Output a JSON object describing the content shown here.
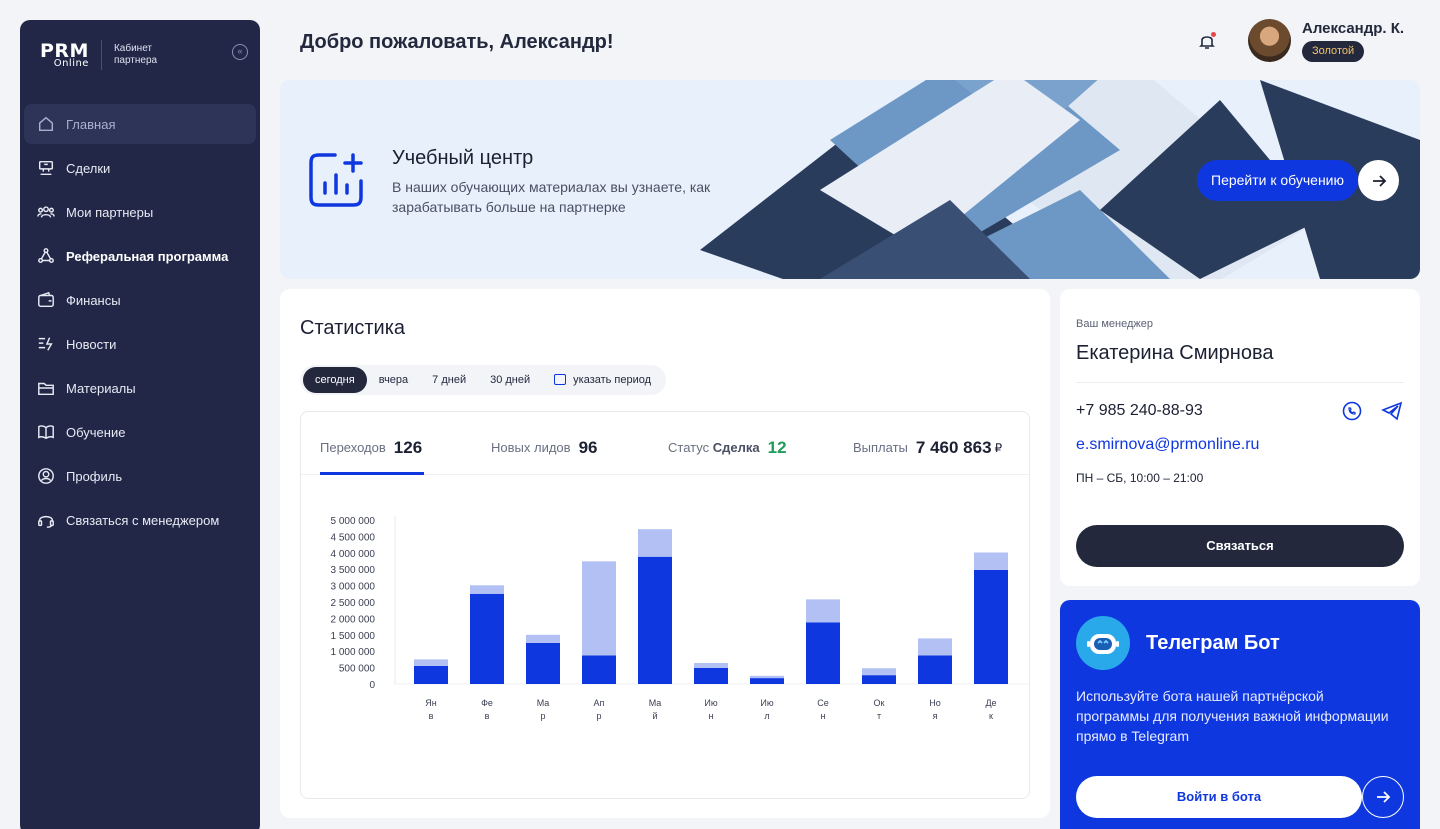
{
  "sidebar": {
    "logo_main": "PRM",
    "logo_sub": "Online",
    "logo_caption": "Кабинет партнера",
    "items": [
      {
        "label": "Главная",
        "icon": "home-icon"
      },
      {
        "label": "Сделки",
        "icon": "deals-icon"
      },
      {
        "label": "Мои партнеры",
        "icon": "partners-icon"
      },
      {
        "label": "Реферальная программа",
        "icon": "referral-icon"
      },
      {
        "label": "Финансы",
        "icon": "wallet-icon"
      },
      {
        "label": "Новости",
        "icon": "news-icon"
      },
      {
        "label": "Материалы",
        "icon": "folder-icon"
      },
      {
        "label": "Обучение",
        "icon": "book-icon"
      },
      {
        "label": "Профиль",
        "icon": "profile-icon"
      },
      {
        "label": "Связаться с менеджером",
        "icon": "headset-icon"
      }
    ]
  },
  "header": {
    "welcome": "Добро пожаловать, Александр!",
    "user_name": "Александр. К.",
    "user_badge": "Золотой"
  },
  "banner": {
    "title": "Учебный центр",
    "text": "В наших обучающих материалах вы узнаете, как зарабатывать больше на партнерке",
    "button": "Перейти к обучению"
  },
  "stats": {
    "title": "Статистика",
    "periods": [
      "сегодня",
      "вчера",
      "7 дней",
      "30 дней",
      "указать период"
    ],
    "metrics": {
      "clicks_label": "Переходов",
      "clicks_value": "126",
      "leads_label": "Новых лидов",
      "leads_value": "96",
      "status_label": "Статус",
      "status_name": "Сделка",
      "status_value": "12",
      "payouts_label": "Выплаты",
      "payouts_value": "7 460 863",
      "currency": "₽"
    }
  },
  "chart_data": {
    "type": "bar",
    "stacked": true,
    "categories": [
      "Янв",
      "Фев",
      "Мар",
      "Апр",
      "Май",
      "Июн",
      "Июл",
      "Сен",
      "Окт",
      "Ноя",
      "Дек"
    ],
    "ylim": [
      0,
      5000000
    ],
    "yticks": [
      "0",
      "500 000",
      "1 000 000",
      "1 500 000",
      "2 000 000",
      "2 500 000",
      "3 000 000",
      "3 500 000",
      "4 000 000",
      "4 500 000",
      "5 000 000"
    ],
    "series": [
      {
        "values": [
          550000,
          2750000,
          1250000,
          870000,
          3880000,
          490000,
          180000,
          1880000,
          270000,
          870000,
          3480000
        ],
        "color": "#0f37e0"
      },
      {
        "values": [
          200000,
          260000,
          250000,
          2870000,
          840000,
          150000,
          70000,
          700000,
          210000,
          520000,
          530000
        ],
        "color": "#b3c0f4"
      }
    ]
  },
  "manager": {
    "label": "Ваш менеджер",
    "name": "Екатерина Смирнова",
    "phone": "+7 985 240-88-93",
    "email": "e.smirnova@prmonline.ru",
    "hours": "ПН – СБ, 10:00 – 21:00",
    "button": "Связаться"
  },
  "telegram": {
    "title": "Телеграм Бот",
    "text": "Используйте бота нашей партнёрской программы для получения важной информации прямо в Telegram",
    "button": "Войти в бота"
  }
}
